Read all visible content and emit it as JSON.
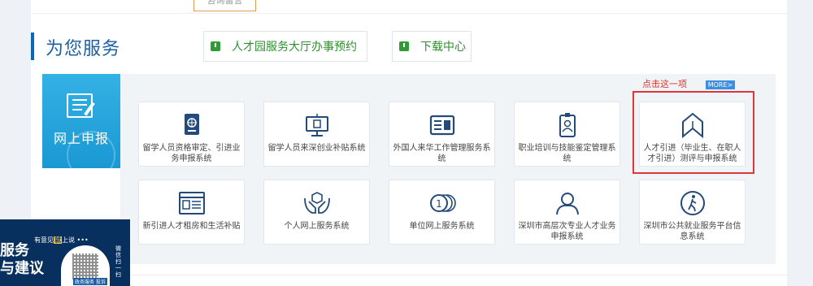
{
  "top_tab": "咨询留言",
  "section": {
    "title": "为您服务"
  },
  "quick_links": [
    {
      "label": "人才园服务大厅办事预约"
    },
    {
      "label": "下载中心"
    }
  ],
  "panel": {
    "card_label": "网上申报",
    "more_label": "MORE>",
    "annotation": "点击这一项",
    "tiles": [
      {
        "label": "留学人员资格审定、引进业务申报系统",
        "icon": "passport-icon"
      },
      {
        "label": "留学人员来深创业补贴系统",
        "icon": "monitor-icon"
      },
      {
        "label": "外国人来华工作管理服务系统",
        "icon": "id-card-icon"
      },
      {
        "label": "职业培训与技能鉴定管理系统",
        "icon": "badge-icon"
      },
      {
        "label": "人才引进（毕业生、在职人才引进）测评与申报系统",
        "icon": "bookmark-house-icon"
      },
      {
        "label": "新引进人才租房和生活补贴",
        "icon": "document-list-icon"
      },
      {
        "label": "个人网上服务系统",
        "icon": "hands-box-icon"
      },
      {
        "label": "单位网上服务系统",
        "icon": "coins-icon"
      },
      {
        "label": "深圳市高层次专业人才业务申报系统",
        "icon": "person-icon"
      },
      {
        "label": "深圳市公共就业服务平台信息系统",
        "icon": "walking-person-icon"
      }
    ]
  },
  "qr_popup": {
    "title_line1": "服务",
    "title_line2": "与建议",
    "header_text_a": "有意见",
    "header_highlight": "就",
    "header_text_b": "上说 •••",
    "qr_label": "政务服务 投诉",
    "side_text": "微信扫一扫"
  }
}
